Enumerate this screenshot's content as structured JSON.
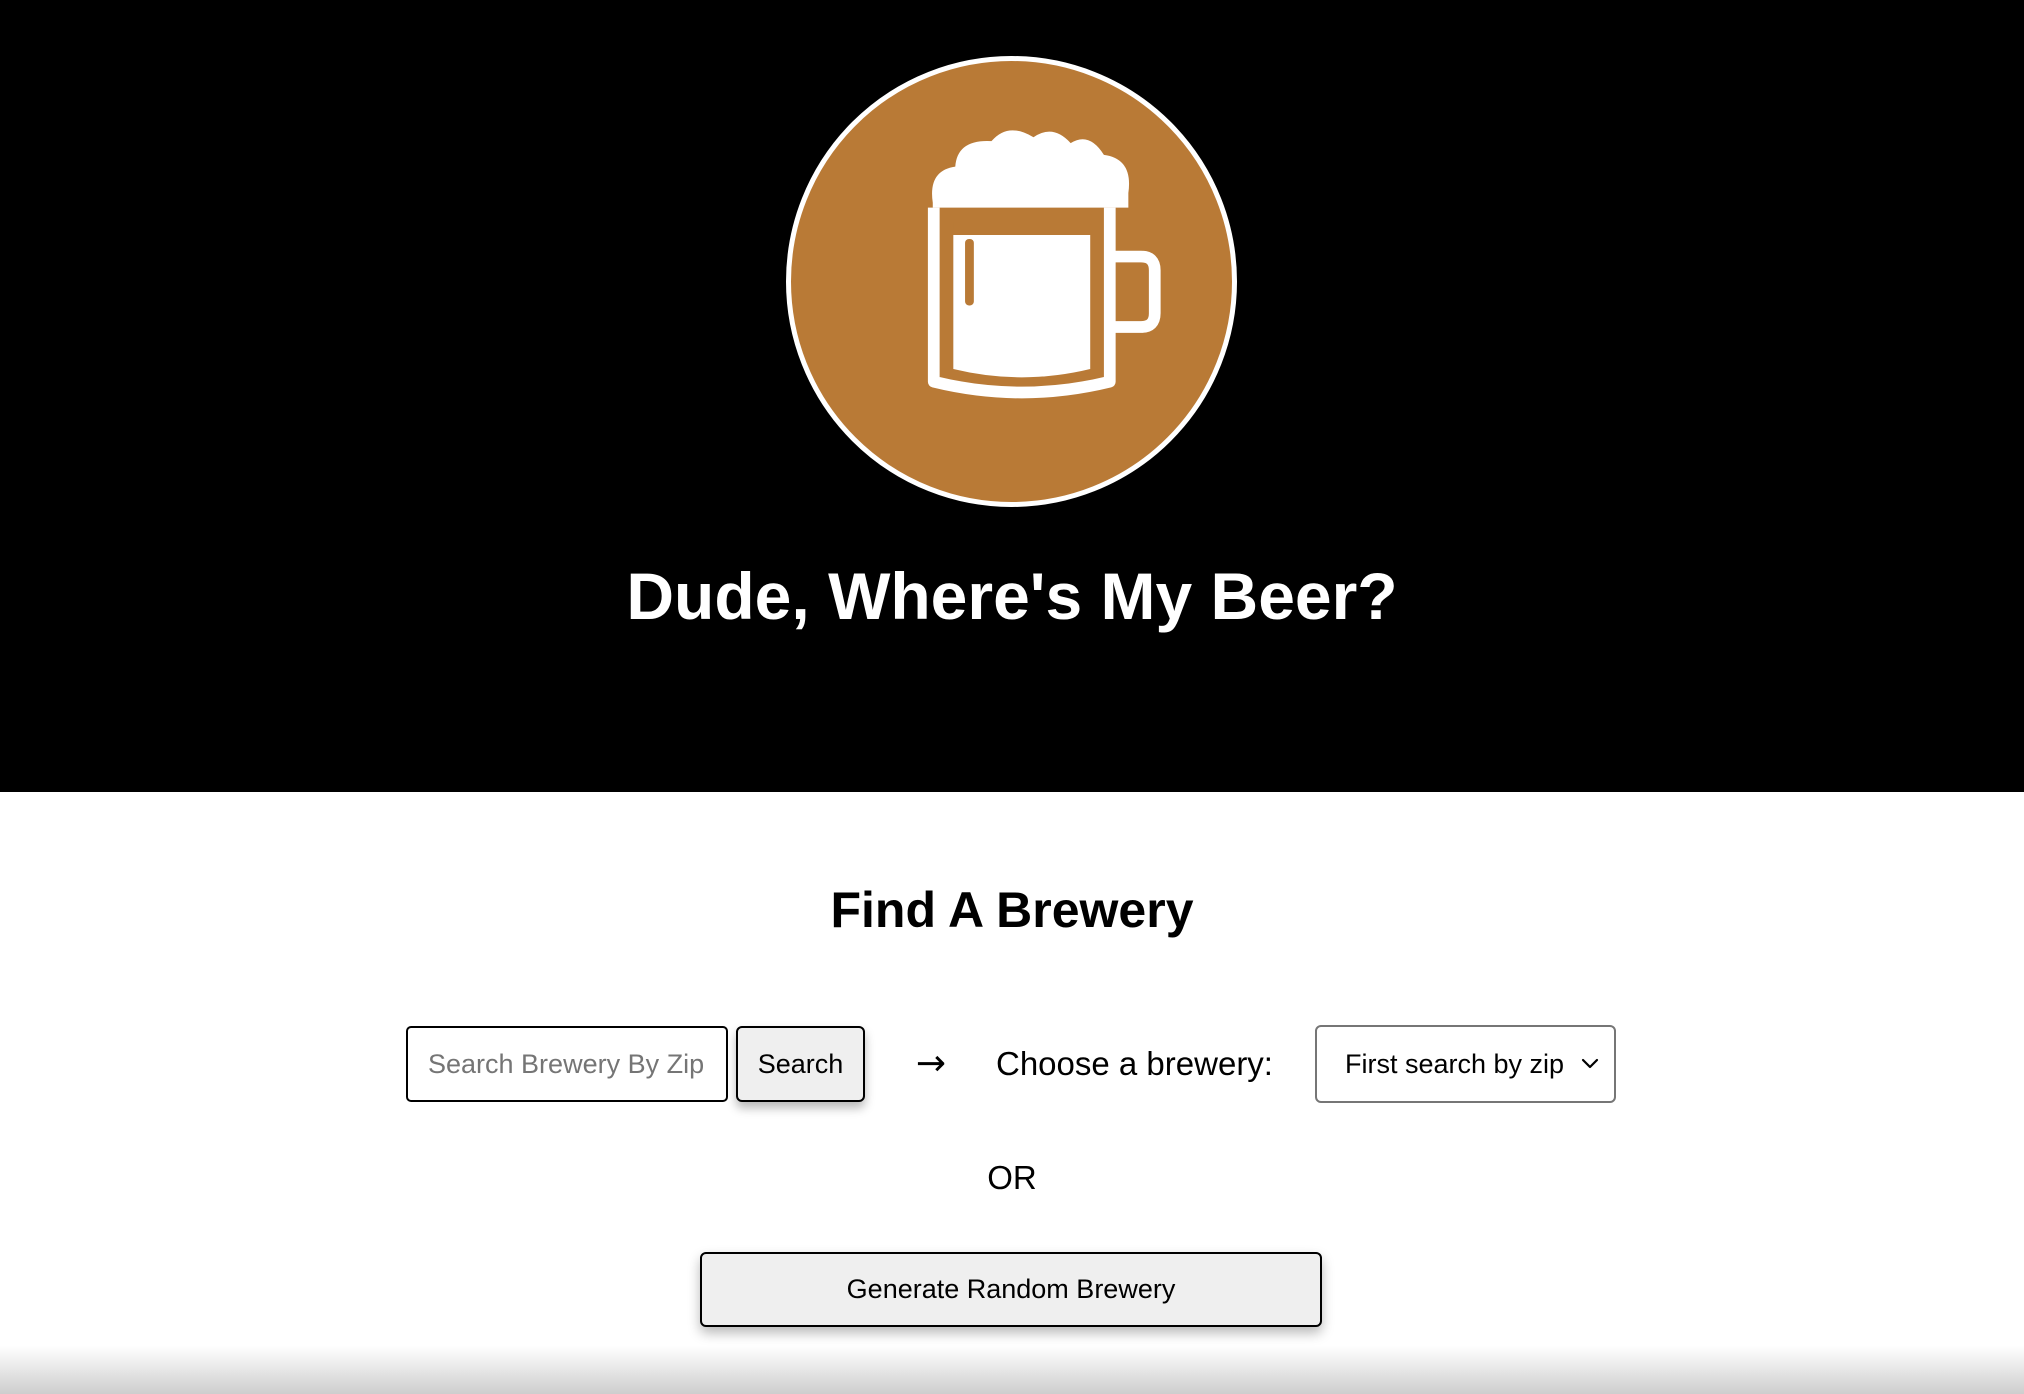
{
  "header": {
    "logo_icon": "beer-mug-icon",
    "logo_color": "#b97a36",
    "title": "Dude, Where's My Beer?"
  },
  "main": {
    "section_title": "Find A Brewery",
    "search": {
      "placeholder": "Search Brewery By Zip",
      "value": "",
      "button_label": "Search"
    },
    "arrow": "→",
    "choose_label": "Choose a brewery:",
    "brewery_select": {
      "selected": "First search by zip"
    },
    "or_text": "OR",
    "random_button_label": "Generate Random Brewery"
  }
}
